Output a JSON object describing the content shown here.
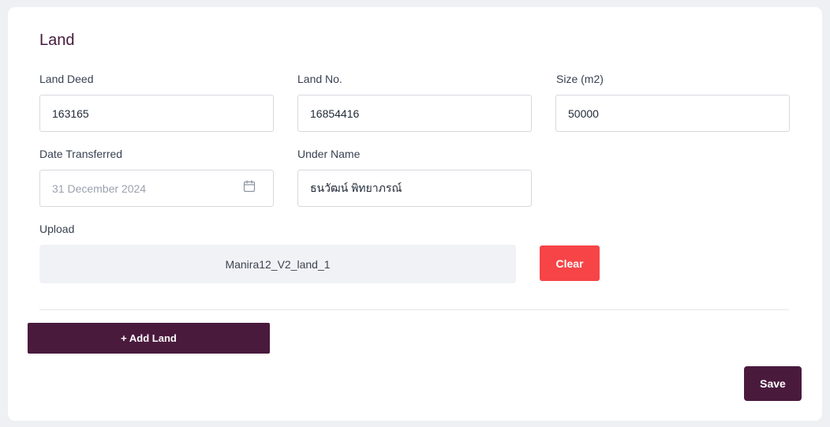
{
  "section": {
    "title": "Land"
  },
  "fields": {
    "land_deed": {
      "label": "Land Deed",
      "value": "163165"
    },
    "land_no": {
      "label": "Land No.",
      "value": "16854416"
    },
    "size": {
      "label": "Size (m2)",
      "value": "50000"
    },
    "date_transferred": {
      "label": "Date Transferred",
      "value": "31 December 2024",
      "icon": "calendar-icon"
    },
    "under_name": {
      "label": "Under Name",
      "value": "ธนวัฒน์ พิทยาภรณ์"
    }
  },
  "upload": {
    "label": "Upload",
    "file_name": "Manira12_V2_land_1",
    "clear_label": "Clear"
  },
  "actions": {
    "add_land_label": "+ Add Land",
    "save_label": "Save"
  },
  "colors": {
    "brand": "#4a1a3d",
    "danger": "#f64447",
    "title": "#451a3d"
  }
}
